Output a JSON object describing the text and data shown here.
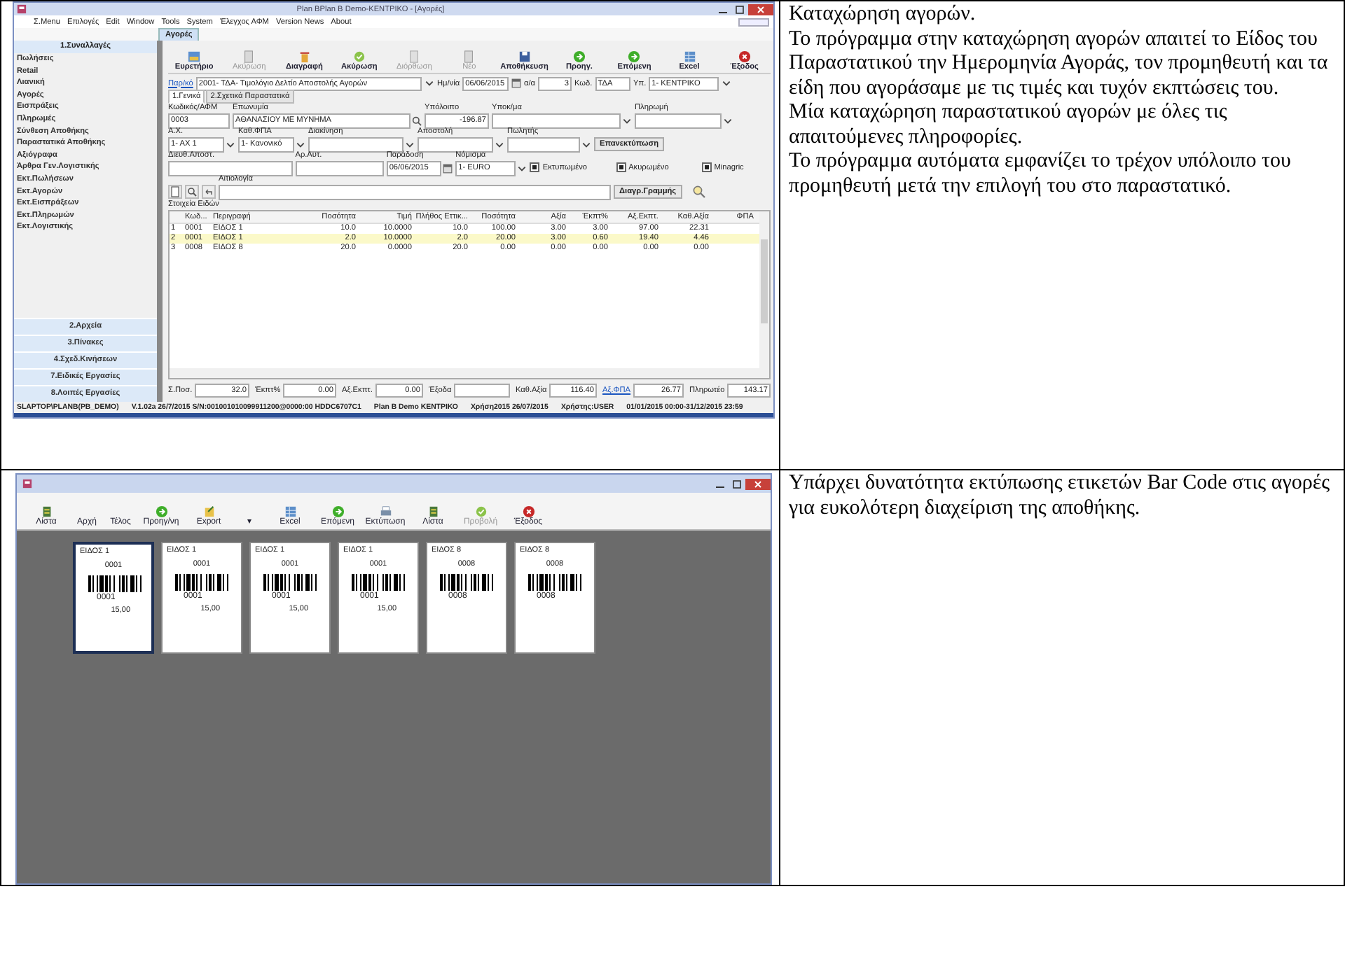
{
  "purchase_entry": {
    "window": {
      "title": "Plan BPlan B Demo-ΚΕΝΤΡΙΚΟ - [Αγορές]"
    },
    "menu": [
      "Σ.Menu",
      "Επιλογές",
      "Edit",
      "Window",
      "Tools",
      "System",
      "Έλεγχος ΑΦΜ",
      "Version News",
      "About"
    ],
    "document_tab": "Αγορές",
    "sidebar": {
      "header": "1.Συναλλαγές",
      "items": [
        "Πωλήσεις",
        "Retail",
        "Λιανική",
        "Αγορές",
        "Εισπράξεις",
        "Πληρωμές",
        "Σύνθεση Αποθήκης",
        "Παραστατικά Αποθήκης",
        "Αξιόγραφα",
        "Άρθρα Γεν.Λογιστικής",
        "Εκτ.Πωλήσεων",
        "Εκτ.Αγορών",
        "Εκτ.Εισπράξεων",
        "Εκτ.Πληρωμών",
        "Εκτ.Λογιστικής"
      ],
      "groups": [
        "2.Αρχεία",
        "3.Πίνακες",
        "4.Σχεδ.Κινήσεων",
        "7.Ειδικές Εργασίες",
        "8.Λοιπές Εργασίες"
      ]
    },
    "toolbar": [
      {
        "label": "Ευρετήριο",
        "disabled": false
      },
      {
        "label": "Ακύρωση",
        "disabled": true
      },
      {
        "label": "Διαγραφή",
        "disabled": false
      },
      {
        "label": "Ακύρωση",
        "disabled": false
      },
      {
        "label": "Διόρθωση",
        "disabled": true
      },
      {
        "label": "Νέο",
        "disabled": true
      },
      {
        "label": "Αποθήκευση",
        "disabled": false
      },
      {
        "label": "Προηγ.",
        "disabled": false
      },
      {
        "label": "Επόμενη",
        "disabled": false
      },
      {
        "label": "Excel",
        "disabled": false
      },
      {
        "label": "Έξοδος",
        "disabled": false
      }
    ],
    "header_fields": [
      {
        "kind": "link",
        "label": "Παρ/κό",
        "value": "2001- ΤΔΑ- Τιμολόγιο Δελτίο Αποστολής Αγορών"
      },
      {
        "kind": "date",
        "label": "Ημ/νία",
        "value": "06/06/2015"
      },
      {
        "kind": "amount",
        "label": "α/α",
        "value": "3"
      },
      {
        "kind": "text",
        "label": "Κωδ.",
        "value": "ΤΔΑ"
      },
      {
        "kind": "select",
        "label": "Υπ.",
        "value": "1- ΚΕΝΤΡΙΚΟ"
      }
    ],
    "tabs": [
      {
        "label": "1.Γενικά",
        "selected": true
      },
      {
        "label": "2.Σχετικά Παραστατικά",
        "selected": false
      }
    ],
    "form_rows": [
      [
        {
          "kind": "text",
          "label": "Κωδικός/ΑΦΜ",
          "value": "0003"
        },
        {
          "kind": "lookup",
          "label": "Επωνυμία",
          "value": "ΑΘΑΝΑΣΙΟΥ ΜΕ ΜΥΝΗΜΑ"
        },
        {
          "kind": "amount",
          "label": "Υπόλοιπο",
          "value": "-196.87"
        },
        {
          "kind": "select",
          "label": "Υποκ/μα"
        },
        {
          "kind": "select",
          "label": "Πληρωμή"
        }
      ],
      [
        {
          "kind": "select",
          "label": "Α.Χ.",
          "value": "1- ΑΧ 1"
        },
        {
          "kind": "select",
          "label": "Καθ.ΦΠΑ",
          "value": "1- Κανονικό"
        },
        {
          "kind": "select",
          "label": "Διακίνηση"
        },
        {
          "kind": "select",
          "label": "Αποστολή"
        },
        {
          "kind": "select",
          "label": "Πωλητής"
        },
        {
          "kind": "button",
          "label": "Επανεκτύπωση"
        }
      ],
      [
        {
          "kind": "text",
          "label": "Διευθ.Αποστ."
        },
        {
          "kind": "text",
          "label": "Αρ.Αυτ."
        },
        {
          "kind": "date",
          "label": "Παράδοση",
          "value": "06/06/2015"
        },
        {
          "kind": "select",
          "label": "Νόμισμα",
          "value": "1- EURO"
        },
        {
          "kind": "checkbox",
          "label": "Εκτυπωμένο",
          "checked": true
        },
        {
          "kind": "checkbox",
          "label": "Ακυρωμένο",
          "checked": true
        },
        {
          "kind": "checkbox",
          "label": "Minagric",
          "checked": true
        }
      ],
      [
        {
          "kind": "tools"
        },
        {
          "kind": "text",
          "label": "Αιτιολογία"
        },
        {
          "kind": "button",
          "label": "Διαγρ.Γραμμής"
        },
        {
          "kind": "search"
        }
      ]
    ],
    "items_title": "Στοιχεία Ειδών",
    "table": {
      "columns": [
        "",
        "Κωδ...",
        "Περιγραφή",
        "Ποσότητα",
        "Τιμή",
        "Πλήθος Εττικ...",
        "Ποσότητα",
        "Αξία",
        "Έκπτ%",
        "Αξ.Εκπτ.",
        "Καθ.Αξία",
        "ΦΠΑ"
      ],
      "rows": [
        {
          "selected": false,
          "cells": [
            "1",
            "0001",
            "ΕΙΔΟΣ 1",
            "10.0",
            "10.0000",
            "10.0",
            "100.00",
            "3.00",
            "3.00",
            "97.00",
            "22.31"
          ]
        },
        {
          "selected": true,
          "cells": [
            "2",
            "0001",
            "ΕΙΔΟΣ 1",
            "2.0",
            "10.0000",
            "2.0",
            "20.00",
            "3.00",
            "0.60",
            "19.40",
            "4.46"
          ]
        },
        {
          "selected": false,
          "cells": [
            "3",
            "0008",
            "ΕΙΔΟΣ 8",
            "20.0",
            "0.0000",
            "20.0",
            "0.00",
            "0.00",
            "0.00",
            "0.00",
            "0.00"
          ]
        }
      ]
    },
    "totals": [
      {
        "kind": "text",
        "label": "Σ.Ποσ.",
        "value": "32.0"
      },
      {
        "kind": "text",
        "label": "Έκπτ%",
        "value": "0.00"
      },
      {
        "kind": "text",
        "label": "Αξ.Εκπτ.",
        "value": "0.00"
      },
      {
        "kind": "text",
        "label": "Έξοδα"
      },
      {
        "kind": "text",
        "label": "Καθ.Αξία",
        "value": "116.40"
      },
      {
        "kind": "link",
        "label": "Αξ.ΦΠΑ",
        "value": "26.77"
      },
      {
        "kind": "text",
        "label": "Πληρωτέο",
        "value": "143.17"
      }
    ],
    "status_bar": [
      "SLAPTOP\\PLANB(PB_DEMO)",
      "V.1.02a 26/7/2015 S/N:001001010099911200@0000:00 HDDC6707C1",
      "Plan B Demo ΚΕΝΤΡΙΚΟ",
      "Χρήση2015 26/07/2015",
      "Χρήστης:USER",
      "01/01/2015 00:00-31/12/2015 23:59"
    ]
  },
  "purchase_description": [
    "Καταχώρηση αγορών.",
    "Το πρόγραμμα στην καταχώρηση αγορών απαιτεί το Είδος του Παραστατικού την Ημερομηνία Αγοράς, τον προμηθευτή και τα είδη που αγοράσαμε με τις τιμές και τυχόν εκπτώσεις του.",
    "Μία καταχώρηση παραστατικού αγορών με όλες τις απαιτούμενες πληροφορίες.",
    "Το πρόγραμμα αυτόματα εμφανίζει το τρέχον υπόλοιπο του προμηθευτή μετά την επιλογή του στο παραστατικό."
  ],
  "barcode_labels": {
    "toolbar": [
      {
        "label": "Λίστα",
        "disabled": false
      },
      {
        "label": "Αρχή",
        "disabled": false
      },
      {
        "label": "Τέλος",
        "disabled": false
      },
      {
        "label": "Προηγ/νη",
        "disabled": false
      },
      {
        "label": "Export",
        "disabled": false
      },
      {
        "label": "▾",
        "disabled": false
      },
      {
        "label": "Excel",
        "disabled": false
      },
      {
        "label": "Επόμενη",
        "disabled": false
      },
      {
        "label": "Εκτύπωση",
        "disabled": false
      },
      {
        "label": "Λίστα",
        "disabled": false
      },
      {
        "label": "Προβολή",
        "disabled": true
      },
      {
        "label": "Έξοδος",
        "disabled": false
      }
    ],
    "labels": [
      {
        "selected": true,
        "name": "ΕΙΔΟΣ 1",
        "code": "0001",
        "barcode_text": "0001",
        "price": "15,00"
      },
      {
        "selected": false,
        "name": "ΕΙΔΟΣ 1",
        "code": "0001",
        "barcode_text": "0001",
        "price": "15,00"
      },
      {
        "selected": false,
        "name": "ΕΙΔΟΣ 1",
        "code": "0001",
        "barcode_text": "0001",
        "price": "15,00"
      },
      {
        "selected": false,
        "name": "ΕΙΔΟΣ 1",
        "code": "0001",
        "barcode_text": "0001",
        "price": "15,00"
      },
      {
        "selected": false,
        "name": "ΕΙΔΟΣ 8",
        "code": "0008",
        "barcode_text": "0008"
      },
      {
        "selected": false,
        "name": "ΕΙΔΟΣ 8",
        "code": "0008",
        "barcode_text": "0008"
      }
    ]
  },
  "barcode_description": [
    "Υπάρχει δυνατότητα εκτύπωσης ετικετών Bar Code στις αγορές για ευκολότερη διαχείριση της αποθήκης."
  ]
}
